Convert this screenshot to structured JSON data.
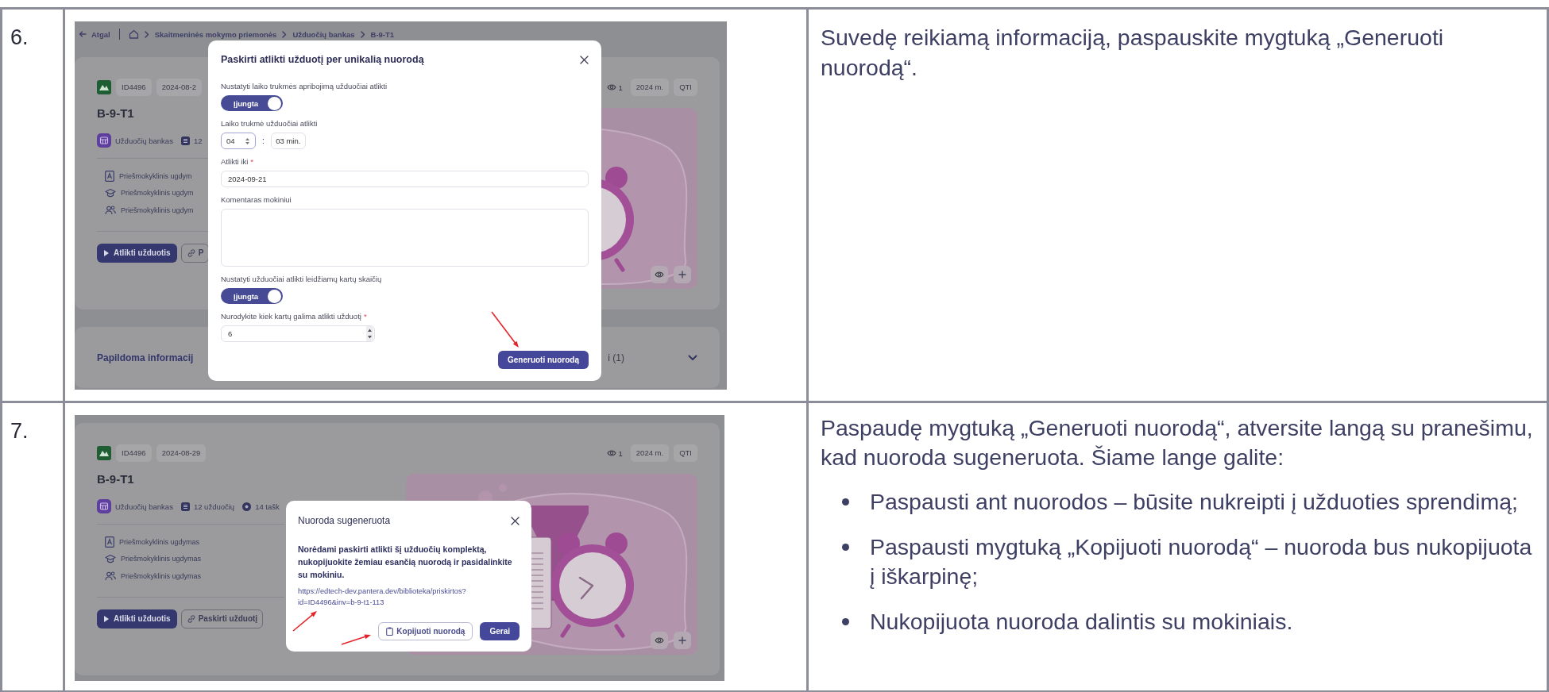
{
  "table": {
    "rows": [
      {
        "number": "6.",
        "screenshot": {
          "breadcrumb": {
            "back": "Atgal",
            "items": [
              "Skaitmeninės mokymo priemonės",
              "Užduočių bankas",
              "B-9-T1"
            ]
          },
          "card": {
            "tags": [
              "ID4496",
              "2024-08-2"
            ],
            "views": "1",
            "badges": [
              "2024 m.",
              "QTI"
            ],
            "title": "B-9-T1",
            "meta": [
              "Užduočių bankas",
              "12"
            ],
            "details": [
              "Priešmokyklinis ugdym",
              "Priešmokyklinis ugdym",
              "Priešmokyklinis ugdym"
            ],
            "buttons": [
              {
                "label": "Atlikti užduotis",
                "kind": "primary"
              },
              {
                "label": "P",
                "kind": "outline"
              }
            ]
          },
          "section": {
            "title": "Papildoma informacij",
            "count": "i (1)"
          },
          "dialog": {
            "kind": "form",
            "title": "Paskirti atlikti užduotį per unikalią nuorodą",
            "fields": [
              {
                "kind": "toggle",
                "label": "Nustatyti laiko trukmės apribojimą užduočiai atlikti",
                "value": "Įjungta",
                "on": true
              },
              {
                "kind": "duration",
                "label": "Laiko trukmė užduočiai atlikti",
                "hours": "04",
                "separator": ":",
                "minutes": "03 min."
              },
              {
                "kind": "text",
                "label": "Atlikti iki",
                "required_mark": "*",
                "value": "2024-09-21"
              },
              {
                "kind": "textarea",
                "label": "Komentaras mokiniui"
              },
              {
                "kind": "toggle",
                "label": "Nustatyti užduočiai atlikti leidžiamų kartų skaičių",
                "value": "Įjungta",
                "on": true
              },
              {
                "kind": "number",
                "label": "Nurodykite kiek kartų galima atlikti užduotį",
                "required_mark": "*",
                "value": "6"
              }
            ],
            "buttons": [
              {
                "label": "Generuoti nuorodą",
                "kind": "primary"
              }
            ]
          }
        },
        "instruction": {
          "paragraph": "Suvedę reikiamą informaciją, paspauskite mygtuką „Generuoti nuorodą“."
        }
      },
      {
        "number": "7.",
        "screenshot": {
          "card": {
            "tags": [
              "ID4496",
              "2024-08-29"
            ],
            "views": "1",
            "badges": [
              "2024 m.",
              "QTI"
            ],
            "title": "B-9-T1",
            "meta": [
              "Užduočių bankas",
              "12 užduočių",
              "14 tašk"
            ],
            "details": [
              "Priešmokyklinis ugdymas",
              "Priešmokyklinis ugdymas",
              "Priešmokyklinis ugdymas"
            ],
            "buttons": [
              {
                "label": "Atlikti užduotis",
                "kind": "primary"
              },
              {
                "label": "Paskirti užduotį",
                "kind": "outline"
              }
            ]
          },
          "dialog": {
            "kind": "message",
            "title": "Nuoroda sugeneruota",
            "text": "Norėdami paskirti atlikti šį užduočių komplektą, nukopijuokite žemiau esančią nuorodą ir pasidalinkite su mokiniu.",
            "link": "https://edtech-dev.pantera.dev/biblioteka/priskirtos?id=ID4496&inv=b-9-t1-113",
            "buttons": [
              {
                "label": "Kopijuoti nuorodą",
                "kind": "outline"
              },
              {
                "label": "Gerai",
                "kind": "primary"
              }
            ]
          }
        },
        "instruction": {
          "paragraph": "Paspaudę mygtuką „Generuoti nuorodą“, atversite langą su pranešimu, kad nuoroda sugeneruota. Šiame lange galite:",
          "bullets": [
            "Paspausti ant nuorodos – būsite nukreipti į užduoties sprendimą;",
            "Paspausti mygtuką „Kopijuoti nuorodą“ – nuoroda bus nukopijuota į iškarpinę;",
            "Nukopijuota nuoroda dalintis su mokiniais."
          ]
        }
      }
    ]
  }
}
